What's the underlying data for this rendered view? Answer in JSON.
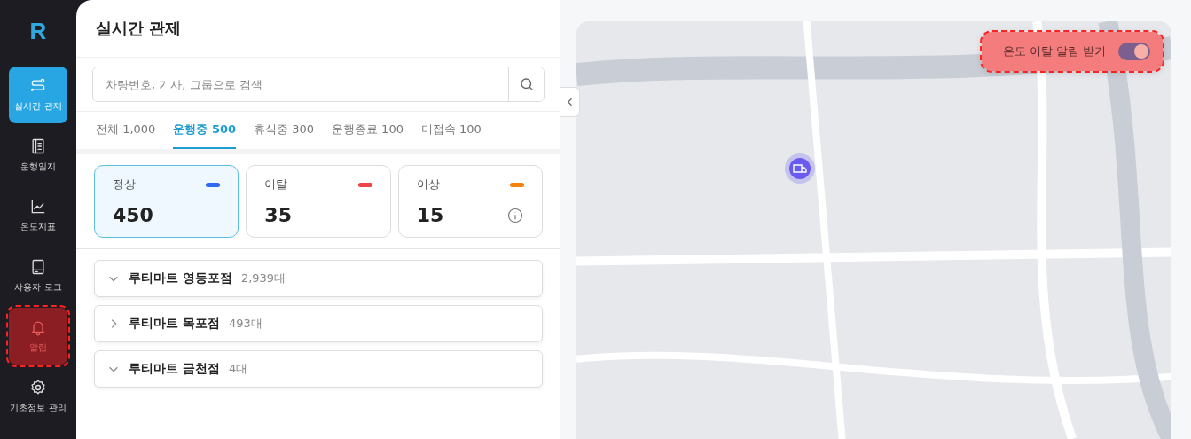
{
  "sidebar": {
    "logo": "R",
    "items": [
      {
        "label": "실시간 관제",
        "selected": true,
        "highlighted": false
      },
      {
        "label": "운행일지",
        "selected": false,
        "highlighted": false
      },
      {
        "label": "온도지표",
        "selected": false,
        "highlighted": false
      },
      {
        "label": "사용자 로그",
        "selected": false,
        "highlighted": false
      },
      {
        "label": "알림",
        "selected": false,
        "highlighted": true
      },
      {
        "label": "기초정보 관리",
        "selected": false,
        "highlighted": false
      }
    ]
  },
  "page_title": "실시간 관제",
  "search": {
    "placeholder": "차량번호, 기사, 그룹으로 검색"
  },
  "tabs": [
    {
      "label": "전체 1,000",
      "selected": false
    },
    {
      "label": "운행중 500",
      "selected": true
    },
    {
      "label": "휴식중 300",
      "selected": false
    },
    {
      "label": "운행종료 100",
      "selected": false
    },
    {
      "label": "미접속 100",
      "selected": false
    }
  ],
  "status_cards": [
    {
      "label": "정상",
      "value": "450",
      "color": "#2f6bf2",
      "selected": true,
      "info": false
    },
    {
      "label": "이탈",
      "value": "35",
      "color": "#f0424a",
      "selected": false,
      "info": false
    },
    {
      "label": "이상",
      "value": "15",
      "color": "#f5820d",
      "selected": false,
      "info": true
    }
  ],
  "groups": [
    {
      "name": "루티마트 영등포점",
      "count": "2,939대",
      "expanded": true
    },
    {
      "name": "루티마트 목포점",
      "count": "493대",
      "expanded": false
    },
    {
      "name": "루티마트 금천점",
      "count": "4대",
      "expanded": true
    }
  ],
  "map": {
    "alert_toggle": {
      "label": "온도 이탈 알림 받기",
      "on": true,
      "highlighted": true
    }
  }
}
